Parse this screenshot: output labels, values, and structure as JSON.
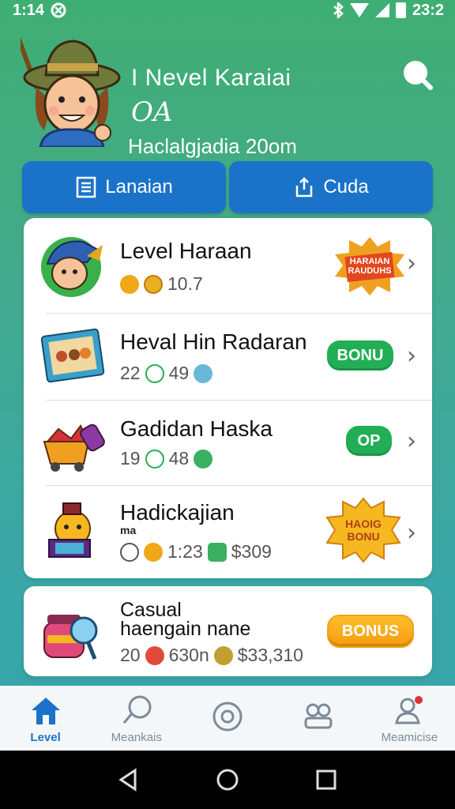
{
  "status_bar": {
    "time": "1:14",
    "clock_right": "23:2"
  },
  "header": {
    "title": "I Nevel Karaiai",
    "badge": "OA",
    "subtitle": "Haclalgjadia 20om"
  },
  "tabs": [
    {
      "label": "Lanaian",
      "icon": "list-icon"
    },
    {
      "label": "Cuda",
      "icon": "share-icon"
    }
  ],
  "list": [
    {
      "title": "Level Haraan",
      "meta": [
        "10.7"
      ],
      "badge": {
        "type": "starburst",
        "line1": "HARAIAN",
        "line2": "RAUDUHS"
      }
    },
    {
      "title": "Heval Hin Radaran",
      "meta": [
        "22",
        "49"
      ],
      "badge": {
        "type": "pill",
        "label": "BONU"
      }
    },
    {
      "title": "Gadidan Haska",
      "meta": [
        "19",
        "48"
      ],
      "badge": {
        "type": "pill",
        "label": "OP"
      }
    },
    {
      "title": "Hadickajian",
      "subtitle": "ma",
      "meta": [
        "1:23",
        "$309"
      ],
      "badge": {
        "type": "starburst",
        "line1": "HAOIG",
        "line2": "BONU"
      }
    }
  ],
  "extra_card": {
    "title_line1": "Casual",
    "title_line2": "haengain nane",
    "meta": [
      "20",
      "630n",
      "$33,310"
    ],
    "button": "BONUS"
  },
  "bottom_nav": [
    {
      "label": "Level",
      "icon": "home-icon",
      "active": true
    },
    {
      "label": "Meankais",
      "icon": "chat-icon",
      "active": false
    },
    {
      "label": "",
      "icon": "disc-icon",
      "active": false
    },
    {
      "label": "",
      "icon": "people-icon",
      "active": false
    },
    {
      "label": "Meamicise",
      "icon": "user-settings-icon",
      "active": false
    }
  ],
  "colors": {
    "accent": "#1a73c9",
    "green": "#22ae55",
    "orange": "#f59b10"
  }
}
